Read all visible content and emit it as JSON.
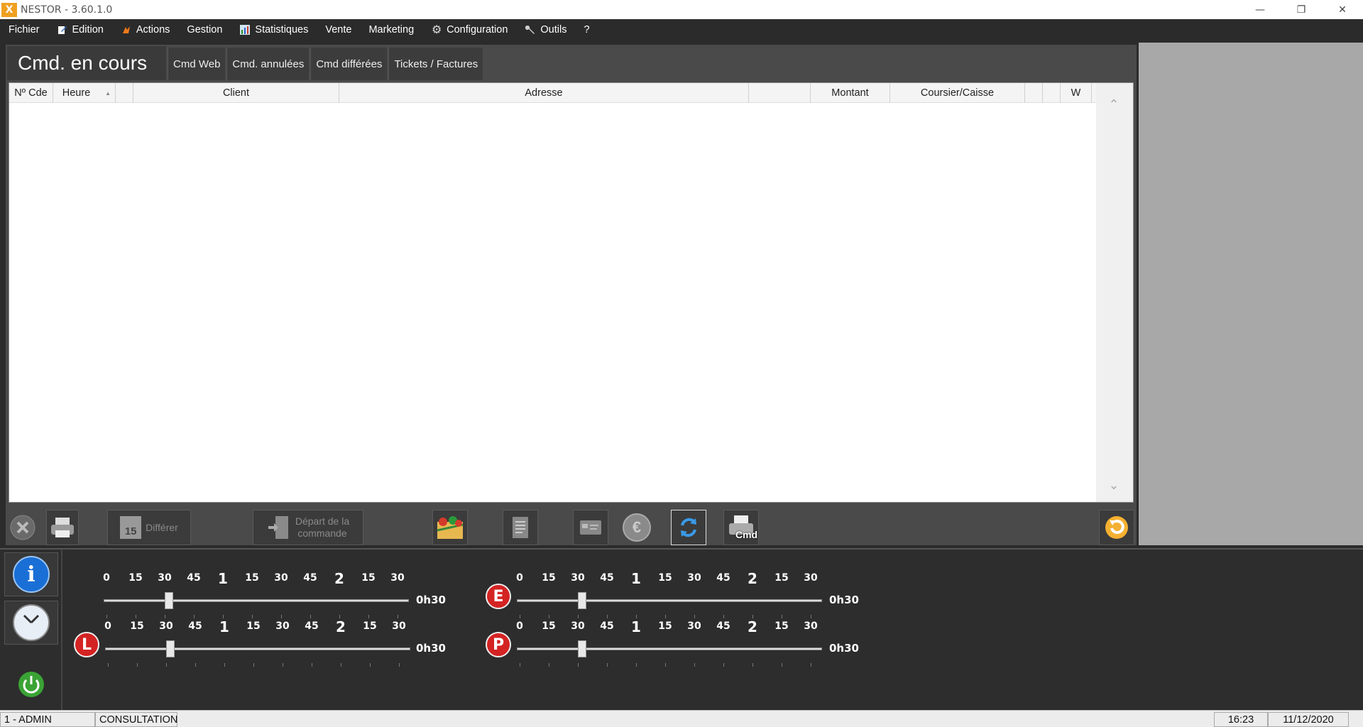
{
  "app": {
    "title": "NESTOR - 3.60.1.0",
    "logo_text": "X"
  },
  "window_controls": {
    "minimize": "—",
    "restore": "❐",
    "close": "✕"
  },
  "menu": [
    {
      "label": "Fichier",
      "icon": ""
    },
    {
      "label": "Edition",
      "icon": "edit-icon"
    },
    {
      "label": "Actions",
      "icon": "actions-icon"
    },
    {
      "label": "Gestion",
      "icon": ""
    },
    {
      "label": "Statistiques",
      "icon": "chart-icon"
    },
    {
      "label": "Vente",
      "icon": ""
    },
    {
      "label": "Marketing",
      "icon": ""
    },
    {
      "label": "Configuration",
      "icon": "gear-icon"
    },
    {
      "label": "Outils",
      "icon": "wrench-icon"
    },
    {
      "label": "?",
      "icon": ""
    }
  ],
  "tabs": {
    "active": "Cmd. en cours",
    "items": [
      "Cmd Web",
      "Cmd. annulées",
      "Cmd différées",
      "Tickets / Factures"
    ]
  },
  "table": {
    "columns": [
      "Nº Cde",
      "Heure",
      "",
      "Client",
      "Adresse",
      "",
      "Montant",
      "Coursier/Caisse",
      "",
      "",
      "W"
    ],
    "sorted_column": "Heure",
    "rows": []
  },
  "toolbar": {
    "differer_label": "Différer",
    "differer_day": "15",
    "depart_line1": "Départ de la",
    "depart_line2": "commande",
    "cmd_label": "Cmd",
    "euro_symbol": "€"
  },
  "sliders": {
    "tick_labels": [
      "0",
      "15",
      "30",
      "45",
      "1",
      "15",
      "30",
      "45",
      "2",
      "15",
      "30"
    ],
    "items": [
      {
        "badge": "",
        "value": "0h30",
        "position_fraction": 0.21
      },
      {
        "badge": "E",
        "value": "0h30",
        "position_fraction": 0.21
      },
      {
        "badge": "L",
        "value": "0h30",
        "position_fraction": 0.21
      },
      {
        "badge": "P",
        "value": "0h30",
        "position_fraction": 0.21
      }
    ]
  },
  "statusbar": {
    "user": "1 - ADMIN",
    "mode": "CONSULTATION",
    "time": "16:23",
    "date": "11/12/2020"
  },
  "colors": {
    "accent_red": "#d42323",
    "info_blue": "#1a6fd6",
    "power_green": "#3aa335"
  }
}
